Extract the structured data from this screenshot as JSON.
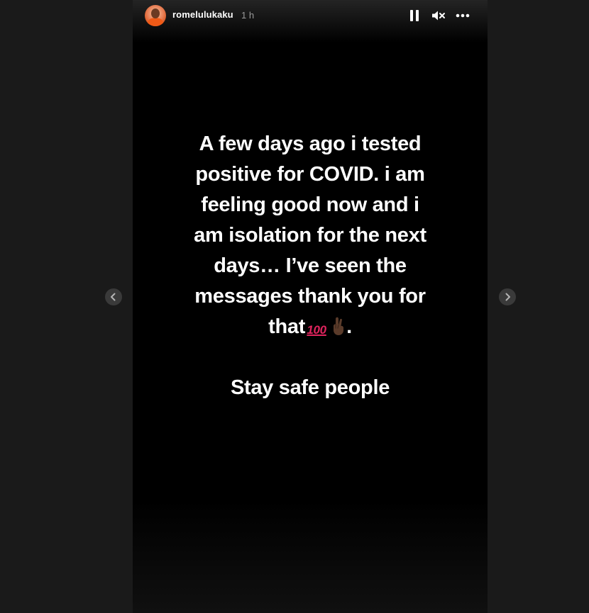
{
  "header": {
    "username": "romelulukaku",
    "timestamp": "1 h"
  },
  "controls": {
    "pause_icon": "pause-icon",
    "mute_icon": "volume-muted-icon",
    "more_icon": "more-options-icon"
  },
  "story": {
    "lines": [
      "A few days ago i tested",
      "positive for COVID. i am",
      "feeling good now and i",
      "am isolation for the next",
      "days… I’ve seen the",
      "messages thank you for"
    ],
    "last_line_prefix": "that",
    "emoji_hundred": "💯",
    "emoji_fingers": "🤞🏿",
    "last_line_suffix": ".",
    "closing": "Stay safe people"
  },
  "navigation": {
    "prev_icon": "chevron-left-icon",
    "next_icon": "chevron-right-icon"
  },
  "colors": {
    "background": "#1a1a1a",
    "story_background": "#000000",
    "text": "#ffffff",
    "muted_text": "#9a9a9a"
  }
}
